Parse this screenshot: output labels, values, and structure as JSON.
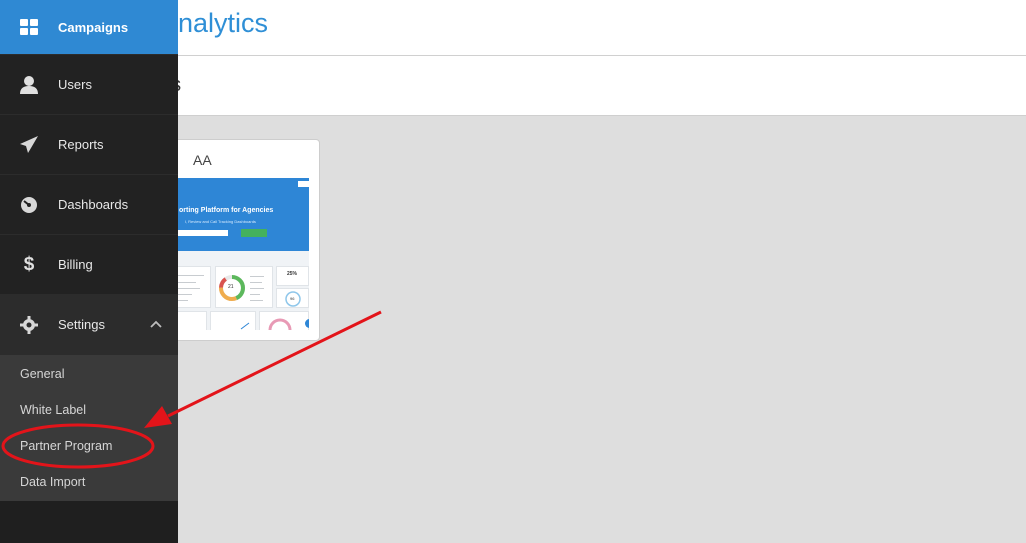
{
  "header": {
    "brand": "Analytics"
  },
  "subheader": {
    "title": "ns"
  },
  "card": {
    "title": "AA",
    "preview": {
      "hero_title": "orting Platform for Agencies",
      "hero_subtitle": "l, Review and Call Tracking Dashboards",
      "donut_value": "21",
      "stat_percent": "25%",
      "gauge_value": "96"
    }
  },
  "sidebar": {
    "items": [
      {
        "label": "Campaigns",
        "icon": "dashboard-grid-icon",
        "active": true
      },
      {
        "label": "Users",
        "icon": "user-icon"
      },
      {
        "label": "Reports",
        "icon": "paper-plane-icon"
      },
      {
        "label": "Dashboards",
        "icon": "gauge-icon"
      },
      {
        "label": "Billing",
        "icon": "dollar-icon"
      },
      {
        "label": "Settings",
        "icon": "gear-icon",
        "expanded": true
      }
    ],
    "settings_submenu": [
      "General",
      "White Label",
      "Partner Program",
      "Data Import"
    ]
  },
  "colors": {
    "accent": "#2f89d3",
    "annotation": "#e3141a",
    "sidebar": "#222222"
  }
}
